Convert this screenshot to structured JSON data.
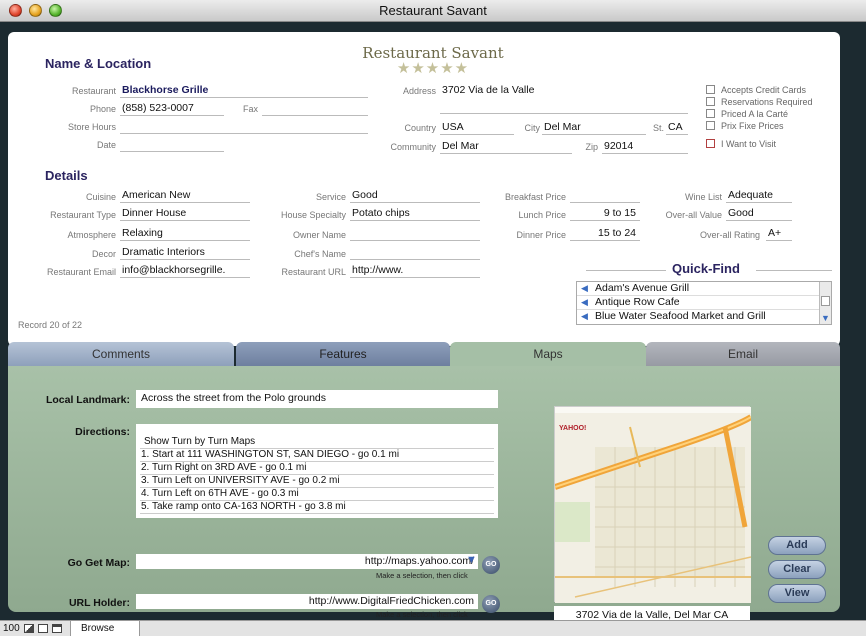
{
  "window": {
    "title": "Restaurant Savant"
  },
  "brand": {
    "name": "Restaurant Savant",
    "stars": "★★★★★"
  },
  "name_location": {
    "heading": "Name & Location",
    "restaurant_label": "Restaurant",
    "restaurant": "Blackhorse Grille",
    "phone_label": "Phone",
    "phone": "(858) 523-0007",
    "fax_label": "Fax",
    "fax": "",
    "store_hours_label": "Store Hours",
    "store_hours": "",
    "date_label": "Date",
    "date": "",
    "address_label": "Address",
    "address": "3702 Via de la Valle",
    "address2": "",
    "country_label": "Country",
    "country": "USA",
    "city_label": "City",
    "city": "Del Mar",
    "state_label": "St.",
    "state": "CA",
    "community_label": "Community",
    "community": "Del Mar",
    "zip_label": "Zip",
    "zip": "92014"
  },
  "checkboxes": [
    {
      "label": "Accepts Credit Cards"
    },
    {
      "label": "Reservations Required"
    },
    {
      "label": "Priced A la Carté"
    },
    {
      "label": "Prix Fixe Prices"
    },
    {
      "label": "I Want to Visit"
    }
  ],
  "details": {
    "heading": "Details",
    "cuisine_label": "Cuisine",
    "cuisine": "American New",
    "type_label": "Restaurant Type",
    "type": "Dinner House",
    "atmosphere_label": "Atmosphere",
    "atmosphere": "Relaxing",
    "decor_label": "Decor",
    "decor": "Dramatic Interiors",
    "email_label": "Restaurant Email",
    "email": "info@blackhorsegrille.",
    "service_label": "Service",
    "service": "Good",
    "specialty_label": "House Specialty",
    "specialty": "Potato chips",
    "owner_label": "Owner Name",
    "owner": "",
    "chef_label": "Chef's Name",
    "chef": "",
    "url_label": "Restaurant URL",
    "url": "http://www.",
    "breakfast_label": "Breakfast Price",
    "breakfast": "",
    "lunch_label": "Lunch Price",
    "lunch": "9 to 15",
    "dinner_label": "Dinner Price",
    "dinner": "15 to 24",
    "wine_label": "Wine List",
    "wine": "Adequate",
    "value_label": "Over-all Value",
    "value": "Good",
    "rating_label": "Over-all Rating",
    "rating": "A+"
  },
  "record": "Record 20 of 22",
  "quick_find": {
    "title": "Quick-Find",
    "items": [
      "Adam's Avenue Grill",
      "Antique Row Cafe",
      "Blue Water Seafood Market and Grill"
    ]
  },
  "tabs": [
    "Comments",
    "Features",
    "Maps",
    "Email"
  ],
  "maps": {
    "landmark_label": "Local Landmark:",
    "landmark": "Across the street from the Polo grounds",
    "directions_label": "Directions:",
    "directions": [
      "Show Turn by Turn Maps",
      "1. Start at 111 WASHINGTON ST, SAN DIEGO - go 0.1 mi",
      "2. Turn Right on 3RD AVE - go 0.1 mi",
      "3. Turn Left on UNIVERSITY AVE - go 0.2 mi",
      "4. Turn Left on 6TH AVE - go 0.3 mi",
      "5. Take ramp onto CA-163 NORTH - go 3.8 mi"
    ],
    "gomap_label": "Go Get Map:",
    "gomap": "http://maps.yahoo.com/",
    "url_holder_label": "URL Holder:",
    "url_holder": "http://www.DigitalFriedChicken.com",
    "hint": "Make a selection, then click",
    "go": "GO",
    "map_caption": "3702 Via de la Valle, Del Mar CA",
    "map_logo": "YAHOO!",
    "buttons": {
      "add": "Add",
      "clear": "Clear",
      "view": "View"
    }
  },
  "status": {
    "zoom": "100",
    "mode": "Browse"
  }
}
